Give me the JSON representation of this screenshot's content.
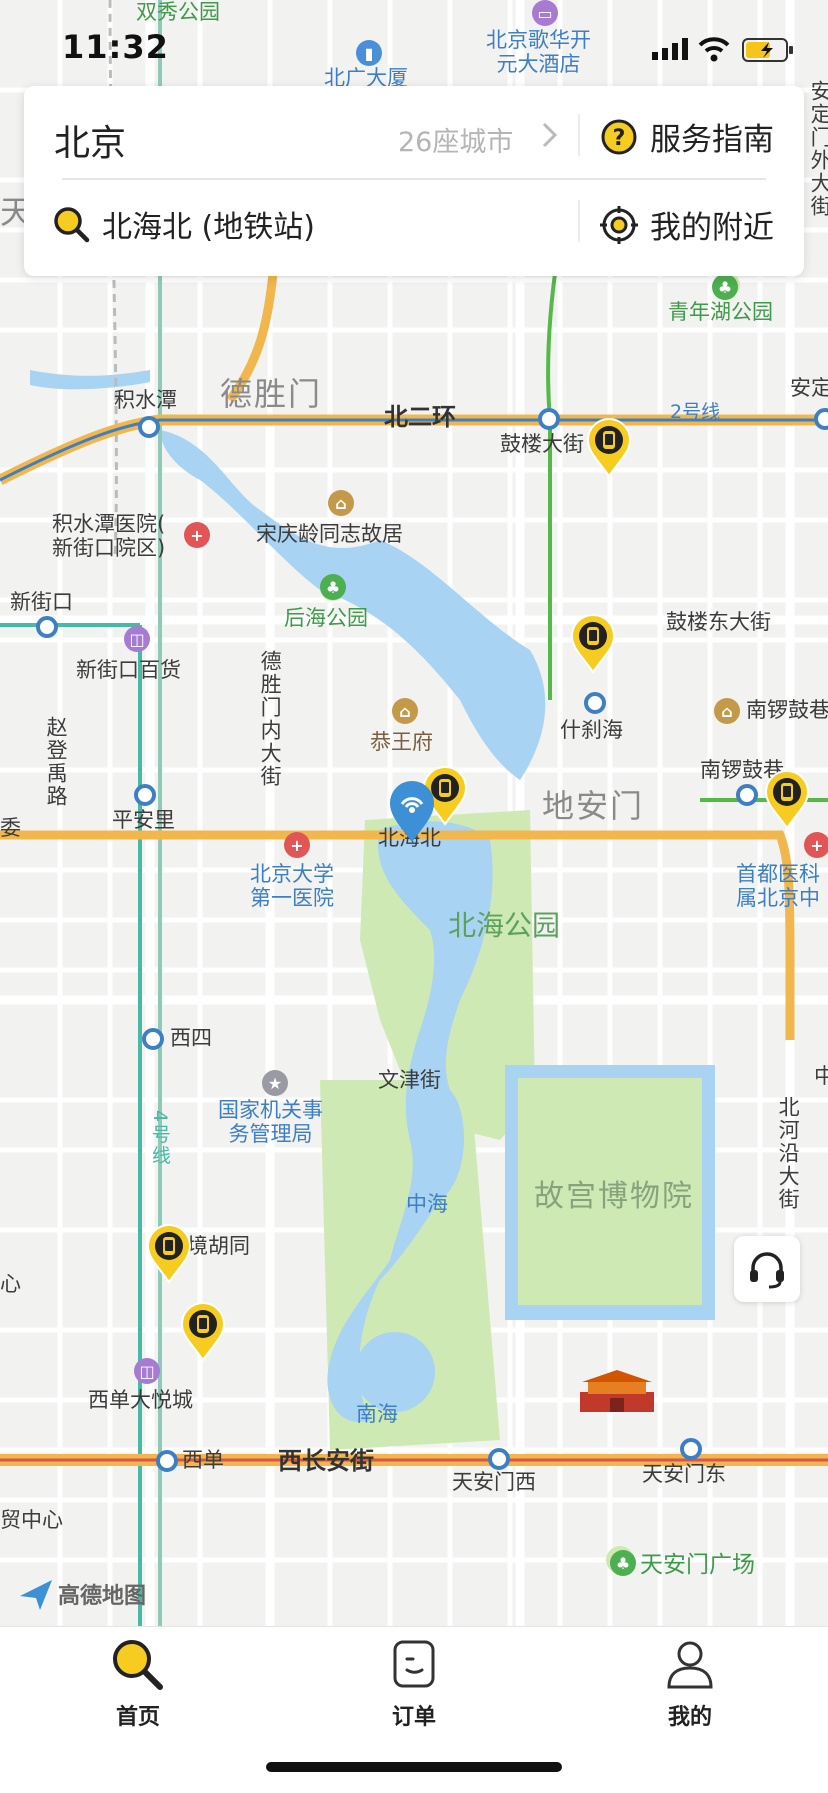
{
  "status_bar": {
    "time": "11:32"
  },
  "header": {
    "city": "北京",
    "city_count": "26座城市",
    "guide_label": "服务指南",
    "search_value": "北海北 (地铁站)",
    "nearby_label": "我的附近"
  },
  "map": {
    "labels": {
      "shuangxiu": "双秀公园",
      "hotel": "北京歌华开\n元大酒店",
      "beiguang": "北广大厦",
      "qingnianhu": "青年湖公园",
      "deshengmen": "德胜门",
      "jishuitan": "积水潭",
      "beierhuan": "北二环",
      "line2": "2号线",
      "gulou_dajie": "鼓楼大街",
      "anding": "安定",
      "jishuitan_hosp": "积水潭医院(\n新街口院区)",
      "songqingling": "宋庆龄同志故居",
      "houhai": "后海公园",
      "xinjiekou": "新街口",
      "xinjiekou_dept": "新街口百货",
      "gulou_dongdajie": "鼓楼东大街",
      "deshengmen_nei": "德胜门内大街",
      "zhaodeng": "赵登禹路",
      "gongwangfu": "恭王府",
      "shichahai": "什刹海",
      "nanluogu1": "南锣鼓巷",
      "nanluogu2": "南锣鼓巷",
      "pinganli": "平安里",
      "beihaibei": "北海北",
      "dianmen": "地安门",
      "bjdx_hosp": "北京大学\n第一医院",
      "shoudu_hosp": "首都医科\n属北京中",
      "beihai_park": "北海公园",
      "xisi": "西四",
      "wenjin": "文津街",
      "guojia": "国家机关事\n务管理局",
      "line4": "4号线",
      "zhongnanhai_zh": "中海",
      "gugong": "故宫博物院",
      "beiheyan": "北河沿大街",
      "lingjing": "灵境胡同",
      "xidan_mall": "西单大悦城",
      "nanhai": "南海",
      "xidan": "西单",
      "xichanganjie": "西长安街",
      "tiananmen_w": "天安门西",
      "tiananmen_e": "天安门东",
      "tiananmen_sq": "天安门广场",
      "jinrong": "贸中心",
      "wei": "委",
      "xin": "心",
      "zhong": "中",
      "tian": "天",
      "an": "安定门外大街"
    },
    "map_logo": "高德地图"
  },
  "tabs": [
    {
      "label": "首页",
      "icon": "search-icon"
    },
    {
      "label": "订单",
      "icon": "order-icon"
    },
    {
      "label": "我的",
      "icon": "user-icon"
    }
  ],
  "colors": {
    "accent_yellow": "#f5cc1f",
    "metro_blue": "#3d7fc4",
    "ring_road": "#f1b74d",
    "water": "#a9d3f2",
    "park": "#cfe9b4"
  }
}
